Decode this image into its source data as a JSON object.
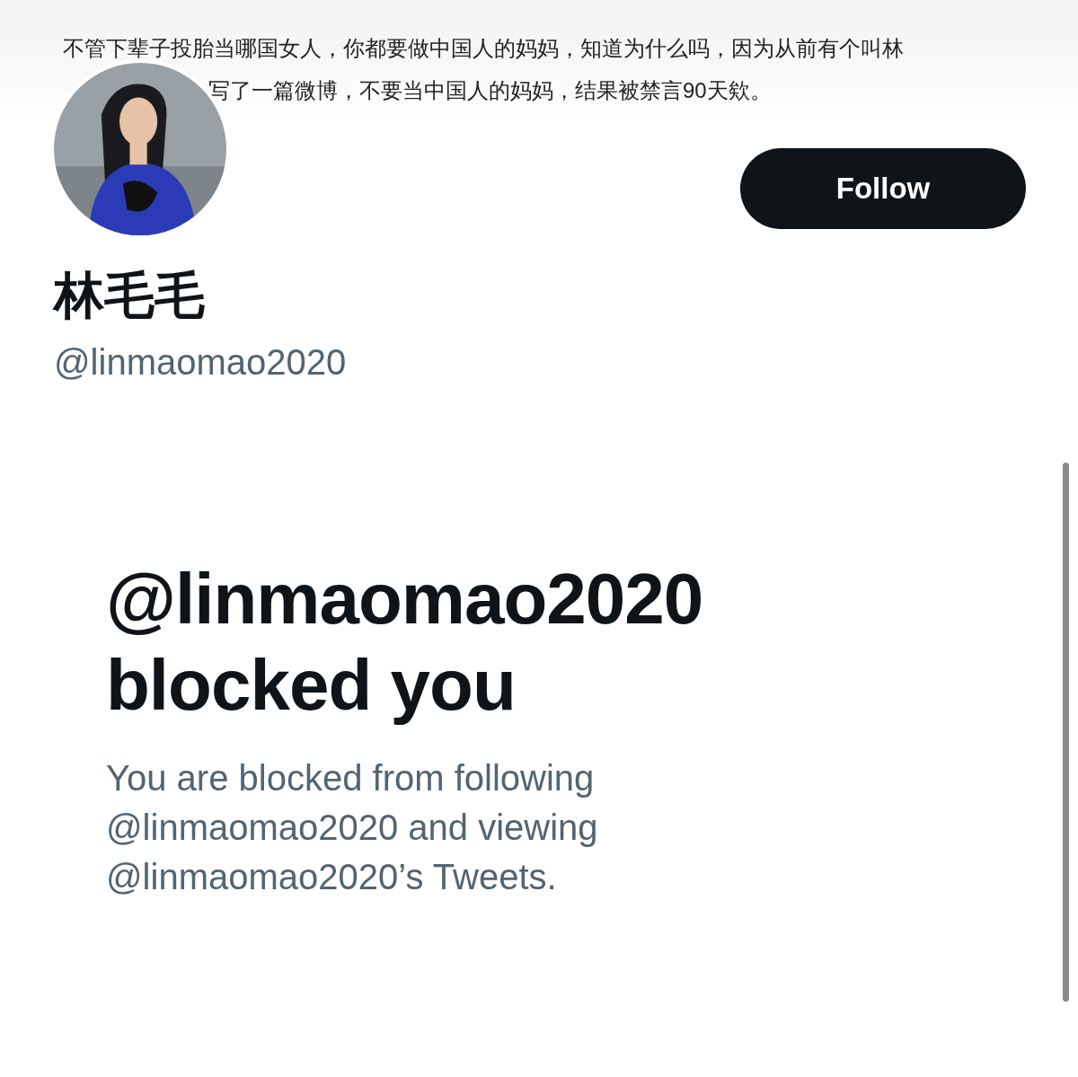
{
  "banner": {
    "lines": [
      "不管下辈子投胎当哪国女人，你都要做中国人的妈妈，知道为什么吗，因为从前有个叫林",
      "写了一篇微博，不要当中国人的妈妈，结果被禁言90天欸。"
    ]
  },
  "profile": {
    "name": "林毛毛",
    "handle": "@linmaomao2020",
    "follow_button": "Follow"
  },
  "blocked": {
    "title_lines": [
      "@linmaomao2020",
      "blocked you"
    ],
    "message_lines": [
      "You are blocked from following",
      "@linmaomao2020 and viewing",
      "@linmaomao2020’s Tweets."
    ]
  }
}
